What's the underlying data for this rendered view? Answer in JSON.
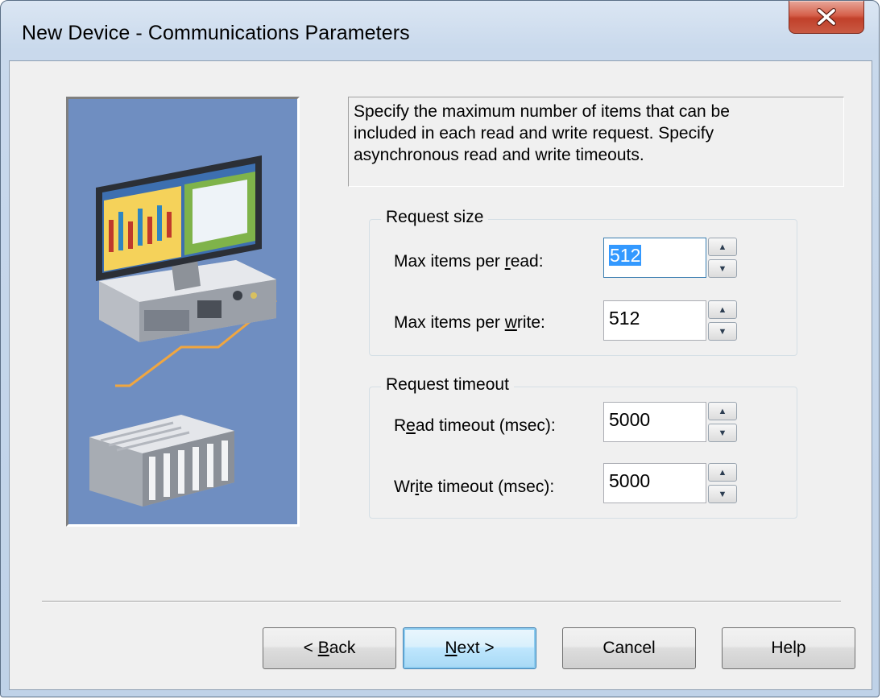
{
  "window": {
    "title": "New Device - Communications Parameters",
    "close_icon": "close-icon"
  },
  "description": {
    "lines": [
      "Specify the maximum number of items that can be",
      "included in each read and write request. Specify",
      "asynchronous read and write timeouts."
    ]
  },
  "request_size": {
    "label": "Request size",
    "read": {
      "label_pre": "Max items per ",
      "label_u": "r",
      "label_post": "ead:",
      "value": "512"
    },
    "write": {
      "label_pre": "Max items per ",
      "label_u": "w",
      "label_post": "rite:",
      "value": "512"
    }
  },
  "request_timeout": {
    "label": "Request timeout",
    "read": {
      "label_pre": "R",
      "label_u": "e",
      "label_post": "ad timeout (msec):",
      "value": "5000"
    },
    "write": {
      "label_pre": "Wr",
      "label_u": "i",
      "label_post": "te timeout (msec):",
      "value": "5000"
    }
  },
  "buttons": {
    "back": {
      "pre": "< ",
      "u": "B",
      "post": "ack"
    },
    "next": {
      "pre": "",
      "u": "N",
      "post": "ext >"
    },
    "cancel": "Cancel",
    "help": "Help"
  },
  "colors": {
    "illustration_bg": "#6f8ec1",
    "selection": "#3399ff",
    "close_button": "#c1402a"
  }
}
